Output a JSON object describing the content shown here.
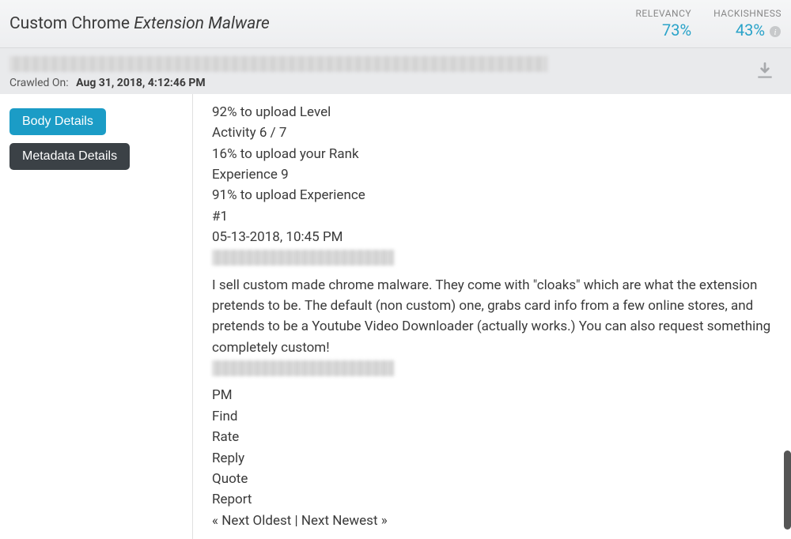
{
  "header": {
    "title_plain": "Custom Chrome ",
    "title_italic": "Extension Malware"
  },
  "metrics": {
    "relevancy": {
      "label": "RELEVANCY",
      "value": "73%"
    },
    "hackishness": {
      "label": "HACKISHNESS",
      "value": "43%"
    }
  },
  "subheader": {
    "crawled_label": "Crawled On:",
    "crawled_date": "Aug 31, 2018, 4:12:46 PM"
  },
  "sidebar": {
    "body_details": "Body Details",
    "metadata_details": "Metadata Details"
  },
  "body": {
    "l1": "92% to upload Level",
    "l2": "Activity 6 / 7",
    "l3": "16% to upload your Rank",
    "l4": "Experience 9",
    "l5": "91% to upload Experience",
    "l6": "#1",
    "l7": "05-13-2018, 10:45 PM",
    "desc": "I sell custom made chrome malware. They come with \"cloaks\" which are what the extension pretends to be. The default (non custom) one, grabs card info from a few online stores, and pretends to be a Youtube Video Downloader (actually works.) You can also request something completely custom!",
    "a1": "PM",
    "a2": "Find",
    "a3": "Rate",
    "a4": "Reply",
    "a5": "Quote",
    "a6": "Report",
    "nav": "« Next Oldest | Next Newest »"
  }
}
